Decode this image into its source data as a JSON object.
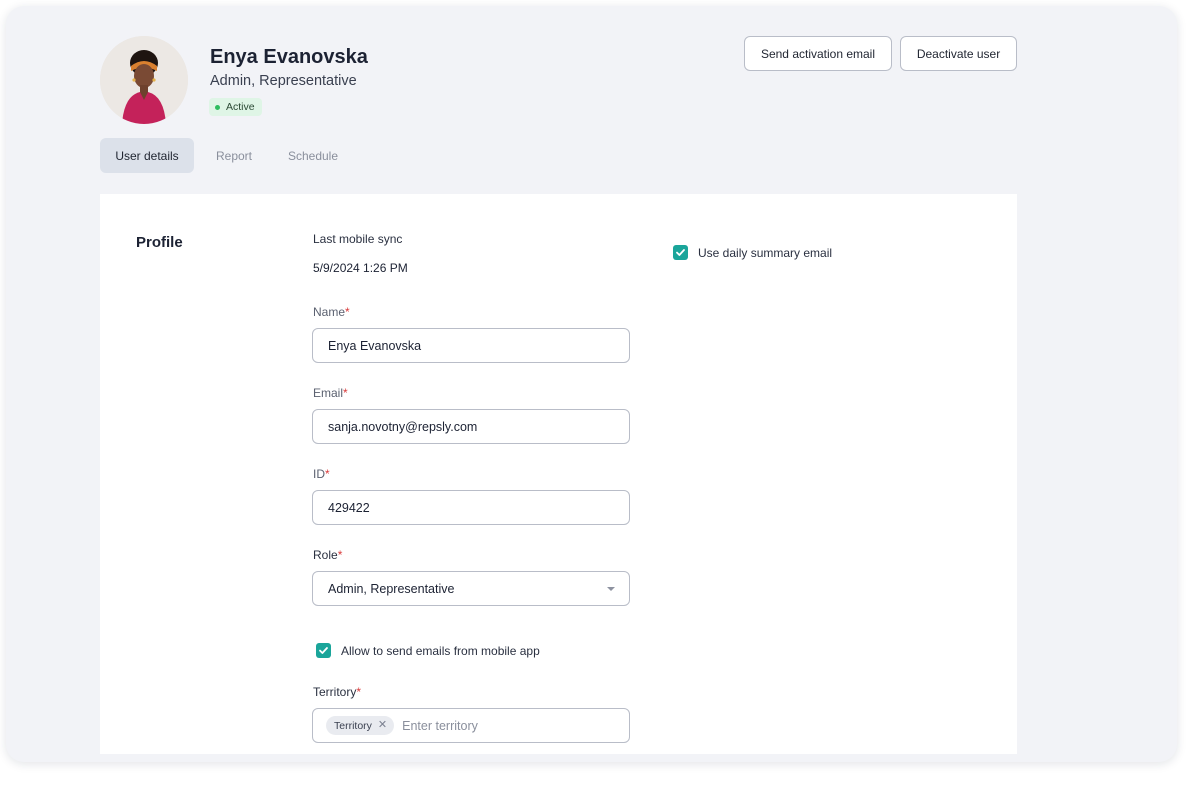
{
  "user": {
    "name": "Enya Evanovska",
    "roles": "Admin, Representative",
    "status": "Active"
  },
  "actions": {
    "send_activation": "Send activation email",
    "deactivate": "Deactivate user"
  },
  "tabs": [
    {
      "label": "User details",
      "active": true
    },
    {
      "label": "Report",
      "active": false
    },
    {
      "label": "Schedule",
      "active": false
    }
  ],
  "profile": {
    "section_title": "Profile",
    "last_sync_label": "Last mobile sync",
    "last_sync_value": "5/9/2024 1:26 PM",
    "name_label": "Name",
    "name_value": "Enya Evanovska",
    "email_label": "Email",
    "email_value": "sanja.novotny@repsly.com",
    "id_label": "ID",
    "id_value": "429422",
    "role_label": "Role",
    "role_value": "Admin, Representative",
    "allow_emails_label": "Allow to send emails from mobile app",
    "allow_emails_checked": true,
    "territory_label": "Territory",
    "territory_chip": "Territory",
    "territory_placeholder": "Enter territory",
    "daily_summary_label": "Use daily summary email",
    "daily_summary_checked": true,
    "required_mark": "*"
  },
  "colors": {
    "accent_teal": "#1aa59a",
    "status_green": "#2ebd5f",
    "status_bg": "#dff5e6",
    "required_red": "#d93a3a",
    "page_bg": "#f2f3f7"
  }
}
